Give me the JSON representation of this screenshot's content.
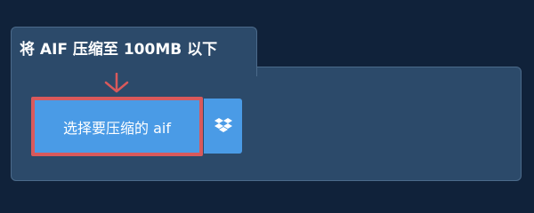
{
  "panel": {
    "title": "将 AIF 压缩至 100MB 以下"
  },
  "upload": {
    "button_label": "选择要压缩的 aif",
    "dropbox_icon": "dropbox-icon",
    "pointer_icon": "arrow-down-icon"
  },
  "colors": {
    "page_background": "#10223a",
    "panel_background": "#2c4a6a",
    "panel_border": "#4b6a8a",
    "button_blue": "#4a9be6",
    "highlight_red": "#d9595b"
  }
}
